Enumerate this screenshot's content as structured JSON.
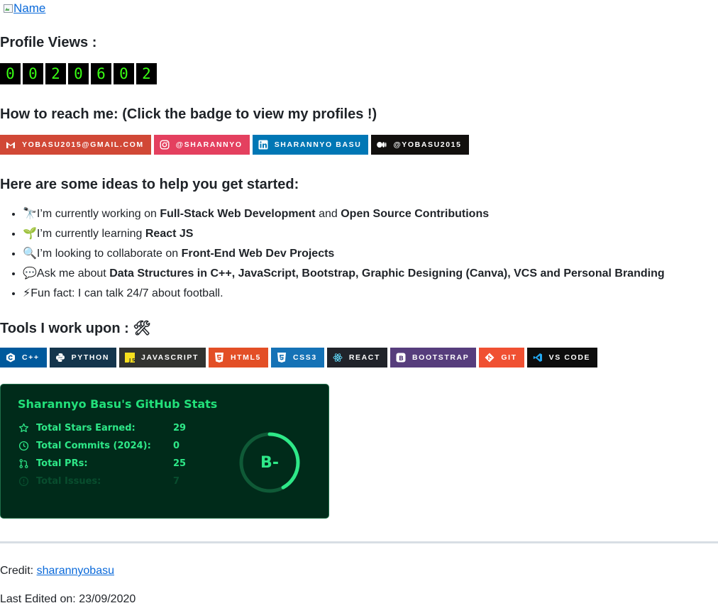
{
  "header": {
    "name_alt": "Name"
  },
  "profile_views": {
    "heading": "Profile Views :",
    "digits": [
      "0",
      "0",
      "2",
      "0",
      "6",
      "0",
      "2"
    ]
  },
  "contact": {
    "heading": "How to reach me: (Click the badge to view my profiles !)",
    "badges": [
      {
        "label": "YOBASU2015@GMAIL.COM",
        "color": "#d14836",
        "icon": "gmail-icon"
      },
      {
        "label": "@SHARANNYO",
        "color": "#e4405f",
        "icon": "instagram-icon"
      },
      {
        "label": "SHARANNYO BASU",
        "color": "#0077b5",
        "icon": "linkedin-icon"
      },
      {
        "label": "@YOBASU2015",
        "color": "#12100e",
        "icon": "medium-icon"
      }
    ]
  },
  "ideas": {
    "heading": "Here are some ideas to help you get started:",
    "items": [
      {
        "emoji": "🔭",
        "pre": "I’m currently working on ",
        "b1": "Full-Stack Web Development",
        "mid": " and ",
        "b2": "Open Source Contributions",
        "post": ""
      },
      {
        "emoji": "🌱",
        "pre": "I’m currently learning ",
        "b1": "React JS",
        "mid": "",
        "b2": "",
        "post": ""
      },
      {
        "emoji": "🔍",
        "pre": "I’m looking to collaborate on ",
        "b1": "Front-End Web Dev Projects",
        "mid": "",
        "b2": "",
        "post": ""
      },
      {
        "emoji": "💬",
        "pre": "Ask me about ",
        "b1": "Data Structures in C++, JavaScript, Bootstrap, Graphic Designing (Canva), VCS and Personal Branding",
        "mid": "",
        "b2": "",
        "post": ""
      },
      {
        "emoji": "⚡",
        "pre": "Fun fact: I can talk 24/7 about football.",
        "b1": "",
        "mid": "",
        "b2": "",
        "post": ""
      }
    ]
  },
  "tools": {
    "heading": "Tools I work upon : 🛠",
    "badges": [
      {
        "label": "C++",
        "color": "#00599c",
        "icon": "cplusplus-icon"
      },
      {
        "label": "PYTHON",
        "color": "#14354c",
        "icon": "python-icon"
      },
      {
        "label": "JAVASCRIPT",
        "color": "#323330",
        "icon": "javascript-icon"
      },
      {
        "label": "HTML5",
        "color": "#e34f26",
        "icon": "html5-icon"
      },
      {
        "label": "CSS3",
        "color": "#1572b6",
        "icon": "css3-icon"
      },
      {
        "label": "REACT",
        "color": "#20232a",
        "icon": "react-icon"
      },
      {
        "label": "BOOTSTRAP",
        "color": "#563d7c",
        "icon": "bootstrap-icon"
      },
      {
        "label": "GIT",
        "color": "#f05032",
        "icon": "git-icon"
      },
      {
        "label": "VS CODE",
        "color": "#0d0d0d",
        "icon": "vscode-icon"
      }
    ]
  },
  "stats": {
    "title": "Sharannyo Basu's GitHub Stats",
    "rows": [
      {
        "label": "Total Stars Earned:",
        "value": "29",
        "icon": "star-icon"
      },
      {
        "label": "Total Commits (2024):",
        "value": "0",
        "icon": "clock-icon"
      },
      {
        "label": "Total PRs:",
        "value": "25",
        "icon": "pull-request-icon"
      },
      {
        "label": "Total Issues:",
        "value": "7",
        "icon": "issue-icon"
      }
    ],
    "rank": "B-",
    "rank_progress": 0.42,
    "colors": {
      "bg": "#002b1a",
      "accent": "#2ee888"
    }
  },
  "footer": {
    "credit_label": "Credit: ",
    "credit_link": "sharannyobasu",
    "last_edited": "Last Edited on: 23/09/2020"
  }
}
